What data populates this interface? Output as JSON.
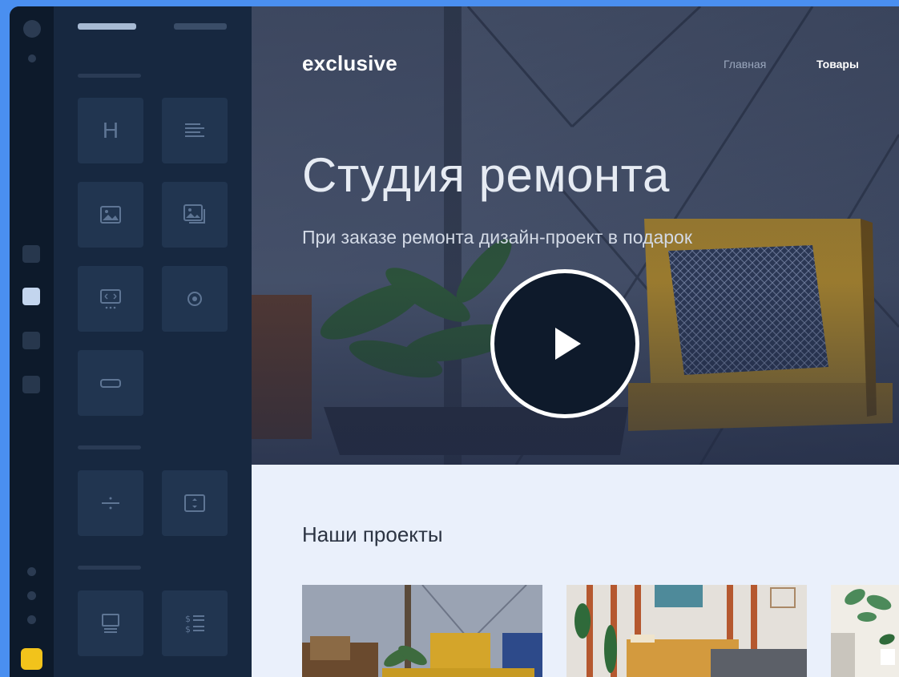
{
  "site": {
    "logo": "exclusive",
    "nav": [
      {
        "label": "Главная"
      },
      {
        "label": "Товары"
      }
    ]
  },
  "hero": {
    "title": "Студия ремонта",
    "subtitle": "При заказе ремонта дизайн-проект в подарок"
  },
  "projects": {
    "title": "Наши проекты"
  },
  "panel": {
    "widgets": [
      {
        "icon": "heading-icon",
        "glyph": "H"
      },
      {
        "icon": "text-block-icon"
      },
      {
        "icon": "image-icon"
      },
      {
        "icon": "gallery-icon"
      },
      {
        "icon": "slider-icon"
      },
      {
        "icon": "radio-icon"
      },
      {
        "icon": "button-icon"
      },
      {
        "icon": "divider-icon"
      },
      {
        "icon": "spacer-icon"
      },
      {
        "icon": "monitor-icon"
      },
      {
        "icon": "price-list-icon"
      }
    ]
  },
  "colors": {
    "accent_yellow": "#f2c31b",
    "background_blue": "#4a8ff0",
    "panel_dark": "#172840",
    "play_button": "#0e1a2b"
  }
}
